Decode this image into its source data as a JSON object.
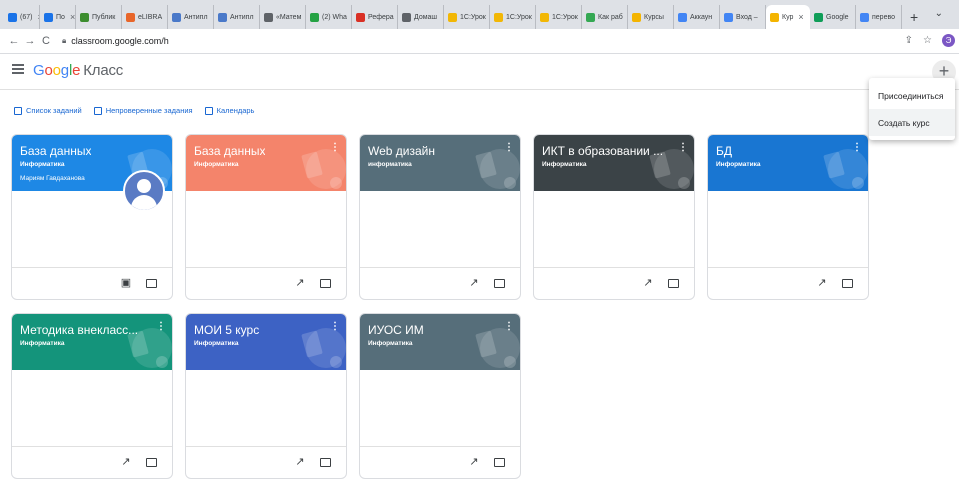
{
  "browser": {
    "tabs": [
      {
        "label": "(67)",
        "color": "#1a73e8",
        "active": false
      },
      {
        "label": "По",
        "color": "#1a73e8",
        "active": false
      },
      {
        "label": "Публик",
        "color": "#3c8d2f",
        "active": false
      },
      {
        "label": "eLIBRA",
        "color": "#e8662a",
        "active": false
      },
      {
        "label": "Антипл",
        "color": "#4a79c9",
        "active": false
      },
      {
        "label": "Антипл",
        "color": "#4a79c9",
        "active": false
      },
      {
        "label": "«Матем",
        "color": "#5f6368",
        "active": false
      },
      {
        "label": "(2) Wha",
        "color": "#25a244",
        "active": false
      },
      {
        "label": "Рефера",
        "color": "#d93025",
        "active": false
      },
      {
        "label": "Домаш",
        "color": "#5f6368",
        "active": false
      },
      {
        "label": "1С:Урок",
        "color": "#f2b705",
        "active": false
      },
      {
        "label": "1С:Урок",
        "color": "#f2b705",
        "active": false
      },
      {
        "label": "1С:Урок",
        "color": "#f2b705",
        "active": false
      },
      {
        "label": "Как раб",
        "color": "#34a853",
        "active": false
      },
      {
        "label": "Курсы",
        "color": "#f4b400",
        "active": false
      },
      {
        "label": "Аккаун",
        "color": "#4285f4",
        "active": false
      },
      {
        "label": "Вход –",
        "color": "#4285f4",
        "active": false
      },
      {
        "label": "Кур",
        "color": "#f4b400",
        "active": true
      },
      {
        "label": "Google",
        "color": "#0f9d58",
        "active": false
      },
      {
        "label": "перево",
        "color": "#4285f4",
        "active": false
      }
    ],
    "new_tab": "+",
    "tab_menu": "⌄",
    "back": "←",
    "forward": "→",
    "reload": "C",
    "url": "classroom.google.com/h",
    "profile_letter": "Э"
  },
  "header": {
    "logo_letters": [
      "G",
      "o",
      "o",
      "g",
      "l",
      "e"
    ],
    "product": "Класс",
    "plus": "+"
  },
  "dropdown": {
    "items": [
      "Присоединиться",
      "Создать курс"
    ]
  },
  "subnav": {
    "items": [
      "Список заданий",
      "Непроверенные задания",
      "Календарь"
    ]
  },
  "courses": [
    {
      "title": "База данных",
      "subject": "Информатика",
      "owner": "Мариям Гавдаханова",
      "color": "#1e88e5",
      "owner_card": true
    },
    {
      "title": "База данных",
      "subject": "Информатика",
      "owner": "",
      "color": "#f4846b",
      "owner_card": false
    },
    {
      "title": "Web дизайн",
      "subject": "информатика",
      "owner": "",
      "color": "#566e7a",
      "owner_card": false
    },
    {
      "title": "ИКТ в образовании ...",
      "subject": "Информатика",
      "owner": "",
      "color": "#3b4347",
      "owner_card": false
    },
    {
      "title": "БД",
      "subject": "Информатика",
      "owner": "",
      "color": "#1976d2",
      "owner_card": false
    },
    {
      "title": "Методика внекласс...",
      "subject": "Информатика",
      "owner": "",
      "color": "#14947b",
      "owner_card": false
    },
    {
      "title": "МОИ 5 курс",
      "subject": "Информатика",
      "owner": "",
      "color": "#3d62c4",
      "owner_card": false
    },
    {
      "title": "ИУОС ИМ",
      "subject": "Информатика",
      "owner": "",
      "color": "#566e7a",
      "owner_card": false
    }
  ],
  "icons": {
    "more": "⋮",
    "trend": "↗",
    "work": "▣"
  }
}
